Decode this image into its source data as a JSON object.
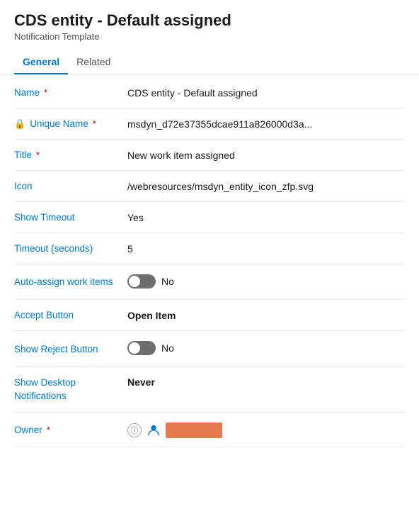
{
  "header": {
    "title": "CDS entity - Default assigned",
    "subtitle": "Notification Template"
  },
  "tabs": [
    {
      "id": "general",
      "label": "General",
      "active": true
    },
    {
      "id": "related",
      "label": "Related",
      "active": false
    }
  ],
  "form": {
    "fields": [
      {
        "id": "name",
        "label": "Name",
        "required": true,
        "value": "CDS entity - Default assigned",
        "bold": false,
        "type": "text"
      },
      {
        "id": "unique-name",
        "label": "Unique Name",
        "required": true,
        "value": "msdyn_d72e37355dcae911a826000d3a...",
        "bold": false,
        "type": "text",
        "locked": true
      },
      {
        "id": "title",
        "label": "Title",
        "required": true,
        "value": "New work item assigned",
        "bold": false,
        "type": "text"
      },
      {
        "id": "icon",
        "label": "Icon",
        "required": false,
        "value": "/webresources/msdyn_entity_icon_zfp.svg",
        "bold": false,
        "type": "text"
      },
      {
        "id": "show-timeout",
        "label": "Show Timeout",
        "required": false,
        "value": "Yes",
        "bold": false,
        "type": "text"
      },
      {
        "id": "timeout-seconds",
        "label": "Timeout (seconds)",
        "required": false,
        "value": "5",
        "bold": false,
        "type": "text"
      },
      {
        "id": "auto-assign",
        "label": "Auto-assign work items",
        "required": false,
        "value": "No",
        "bold": false,
        "type": "toggle",
        "toggled": false
      },
      {
        "id": "accept-button",
        "label": "Accept Button",
        "required": false,
        "value": "Open Item",
        "bold": true,
        "type": "text"
      },
      {
        "id": "show-reject",
        "label": "Show Reject Button",
        "required": false,
        "value": "No",
        "bold": false,
        "type": "toggle",
        "toggled": false
      },
      {
        "id": "show-desktop",
        "label": "Show Desktop Notifications",
        "required": false,
        "value": "Never",
        "bold": true,
        "type": "text"
      },
      {
        "id": "owner",
        "label": "Owner",
        "required": true,
        "value": "",
        "bold": false,
        "type": "owner"
      }
    ]
  },
  "icons": {
    "lock": "🔒",
    "person": "👤",
    "info_circle": "ⓘ"
  }
}
